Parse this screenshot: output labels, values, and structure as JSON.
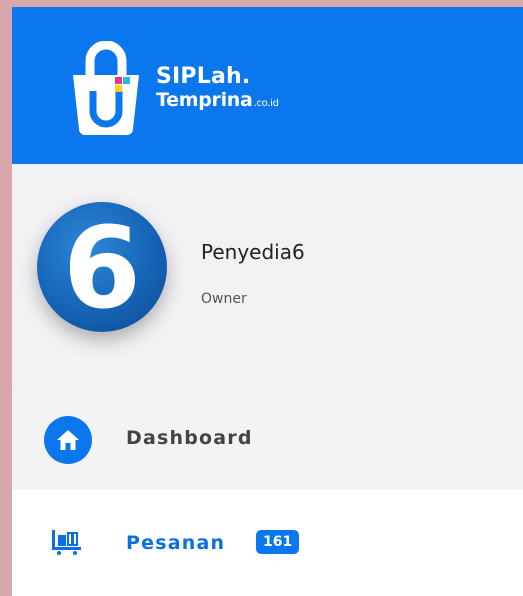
{
  "brand": {
    "line1": "SIPLah.",
    "line2": "Temprina",
    "suffix": ".co.id",
    "header_color": "#0a77ee"
  },
  "user": {
    "avatar_text": "6",
    "name": "Penyedia6",
    "role": "Owner"
  },
  "nav": {
    "dashboard": {
      "label": "Dashboard",
      "icon": "home-icon"
    },
    "pesanan": {
      "label": "Pesanan",
      "badge": "161",
      "icon": "shopping-cart-icon"
    }
  }
}
